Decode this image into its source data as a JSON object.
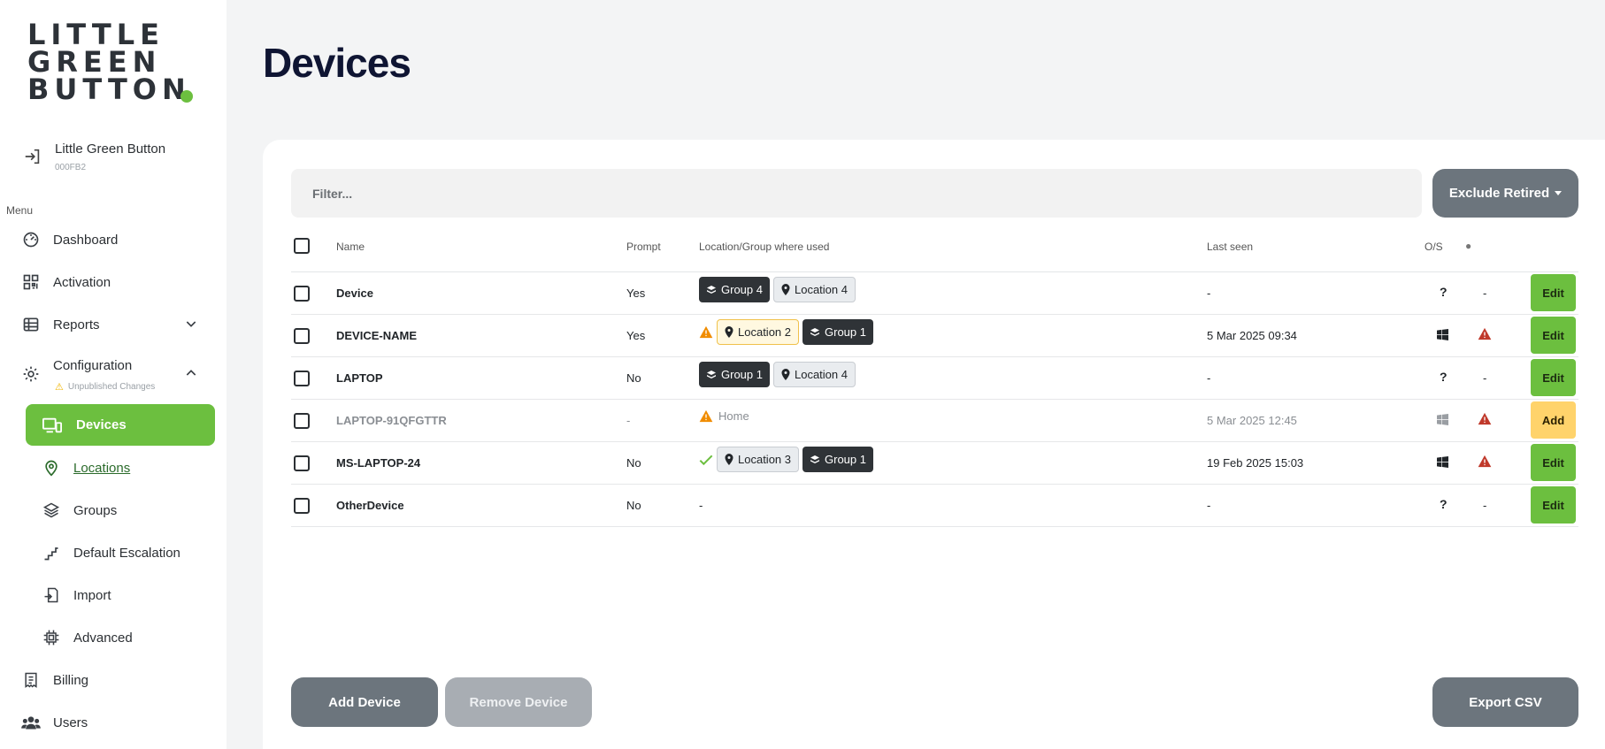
{
  "logo": {
    "line1": "LITTLE",
    "line2": "GREEN",
    "line3": "BUTTON"
  },
  "org": {
    "name": "Little Green Button",
    "code": "000FB2"
  },
  "menu_label": "Menu",
  "nav": {
    "dashboard": "Dashboard",
    "activation": "Activation",
    "reports": "Reports",
    "configuration": "Configuration",
    "config_status": "Unpublished Changes",
    "devices": "Devices",
    "locations": "Locations",
    "groups": "Groups",
    "default_escalation": "Default Escalation",
    "import": "Import",
    "advanced": "Advanced",
    "billing": "Billing",
    "users": "Users"
  },
  "page_title": "Devices",
  "filter": {
    "placeholder": "Filter...",
    "value": ""
  },
  "exclude_button": "Exclude Retired",
  "columns": {
    "name": "Name",
    "prompt": "Prompt",
    "location": "Location/Group where used",
    "last_seen": "Last seen",
    "os": "O/S",
    "status": "●"
  },
  "rows": [
    {
      "name": "Device",
      "prompt": "Yes",
      "tags": [
        "Group 4",
        "Location 4"
      ],
      "last_seen": "-",
      "os": "?",
      "status": "-",
      "action": "Edit"
    },
    {
      "name": "DEVICE-NAME",
      "prompt": "Yes",
      "tags": [
        "Location 2",
        "Group 1"
      ],
      "last_seen": "5 Mar 2025 09:34",
      "os": "windows",
      "status": "warning",
      "action": "Edit"
    },
    {
      "name": "LAPTOP",
      "prompt": "No",
      "tags": [
        "Group 1",
        "Location 4"
      ],
      "last_seen": "-",
      "os": "?",
      "status": "-",
      "action": "Edit"
    },
    {
      "name": "LAPTOP-91QFGTTR",
      "prompt": "-",
      "tags": [
        "Home"
      ],
      "last_seen": "5 Mar 2025 12:45",
      "os": "windows",
      "status": "warning",
      "action": "Add"
    },
    {
      "name": "MS-LAPTOP-24",
      "prompt": "No",
      "tags": [
        "Location 3",
        "Group 1"
      ],
      "last_seen": "19 Feb 2025 15:03",
      "os": "windows",
      "status": "warning",
      "action": "Edit"
    },
    {
      "name": "OtherDevice",
      "prompt": "No",
      "tags": [
        "-"
      ],
      "last_seen": "-",
      "os": "?",
      "status": "-",
      "action": "Edit"
    }
  ],
  "footer": {
    "add": "Add Device",
    "remove": "Remove Device",
    "export": "Export CSV"
  },
  "colors": {
    "brand_green": "#6cbf3f",
    "warning_orange": "#f08c00",
    "danger_red": "#c0392b",
    "button_gray": "#6c757d"
  },
  "icons": [
    "login-icon",
    "dashboard-icon",
    "qr-icon",
    "table-icon",
    "gear-icon",
    "devices-icon",
    "map-pin-icon",
    "layers-icon",
    "stairs-icon",
    "import-icon",
    "chip-icon",
    "receipt-icon",
    "users-icon",
    "windows-icon",
    "warning-icon",
    "check-icon"
  ]
}
